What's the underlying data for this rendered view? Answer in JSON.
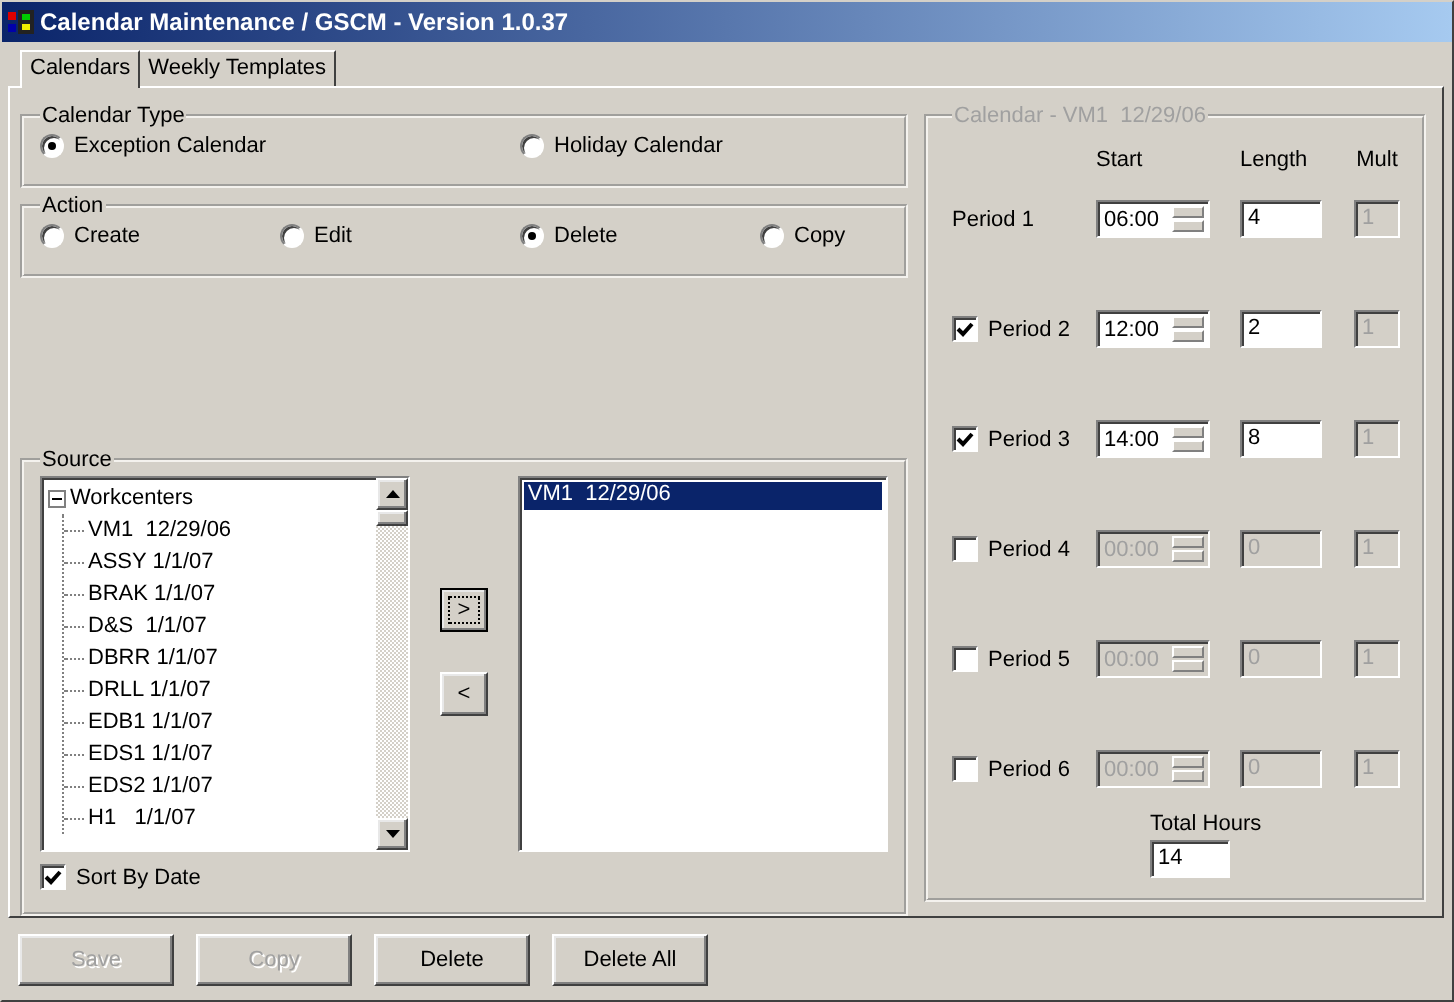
{
  "window": {
    "title": "Calendar Maintenance / GSCM - Version 1.0.37"
  },
  "tabs": [
    {
      "label": "Calendars",
      "selected": true
    },
    {
      "label": "Weekly Templates",
      "selected": false
    }
  ],
  "calendar_type": {
    "label": "Calendar Type",
    "options": [
      {
        "label": "Exception Calendar",
        "selected": true
      },
      {
        "label": "Holiday Calendar",
        "selected": false
      }
    ]
  },
  "action": {
    "label": "Action",
    "options": [
      {
        "label": "Create",
        "selected": false
      },
      {
        "label": "Edit",
        "selected": false
      },
      {
        "label": "Delete",
        "selected": true
      },
      {
        "label": "Copy",
        "selected": false
      }
    ]
  },
  "source": {
    "label": "Source",
    "tree": [
      {
        "label": "Workcenters",
        "expanded": true,
        "children": [
          {
            "label": "VM1  12/29/06"
          },
          {
            "label": "ASSY 1/1/07"
          },
          {
            "label": "BRAK 1/1/07"
          },
          {
            "label": "D&S  1/1/07"
          },
          {
            "label": "DBRR 1/1/07"
          },
          {
            "label": "DRLL 1/1/07"
          },
          {
            "label": "EDB1 1/1/07"
          },
          {
            "label": "EDS1 1/1/07"
          },
          {
            "label": "EDS2 1/1/07"
          },
          {
            "label": "H1   1/1/07"
          }
        ]
      }
    ],
    "move_buttons": [
      {
        "label": ">",
        "focused": true
      },
      {
        "label": "<",
        "focused": false
      }
    ],
    "selected_list": [
      {
        "label": "VM1  12/29/06",
        "selected": true
      }
    ],
    "sort_by_date": {
      "label": "Sort By Date",
      "checked": true
    }
  },
  "calendar": {
    "title": "Calendar - VM1  12/29/06",
    "disabled": true,
    "columns": [
      "Start",
      "Length",
      "Mult"
    ],
    "periods": [
      {
        "kind": "fixed",
        "label": "Period 1",
        "start": "06:00",
        "length": "4",
        "mult": "1",
        "disabled": false
      },
      {
        "kind": "optional",
        "label": "Period 2",
        "checked": true,
        "start": "12:00",
        "length": "2",
        "mult": "1",
        "disabled": false
      },
      {
        "kind": "optional",
        "label": "Period 3",
        "checked": true,
        "start": "14:00",
        "length": "8",
        "mult": "1",
        "disabled": false
      },
      {
        "kind": "optional",
        "label": "Period 4",
        "checked": false,
        "start": "00:00",
        "length": "0",
        "mult": "1",
        "disabled": true
      },
      {
        "kind": "optional",
        "label": "Period 5",
        "checked": false,
        "start": "00:00",
        "length": "0",
        "mult": "1",
        "disabled": true
      },
      {
        "kind": "optional",
        "label": "Period 6",
        "checked": false,
        "start": "00:00",
        "length": "0",
        "mult": "1",
        "disabled": true
      }
    ],
    "total": {
      "label": "Total Hours",
      "value": "14"
    }
  },
  "buttons": [
    {
      "label": "Save",
      "disabled": true
    },
    {
      "label": "Copy",
      "disabled": true
    },
    {
      "label": "Delete",
      "disabled": false
    },
    {
      "label": "Delete All",
      "disabled": false
    }
  ]
}
